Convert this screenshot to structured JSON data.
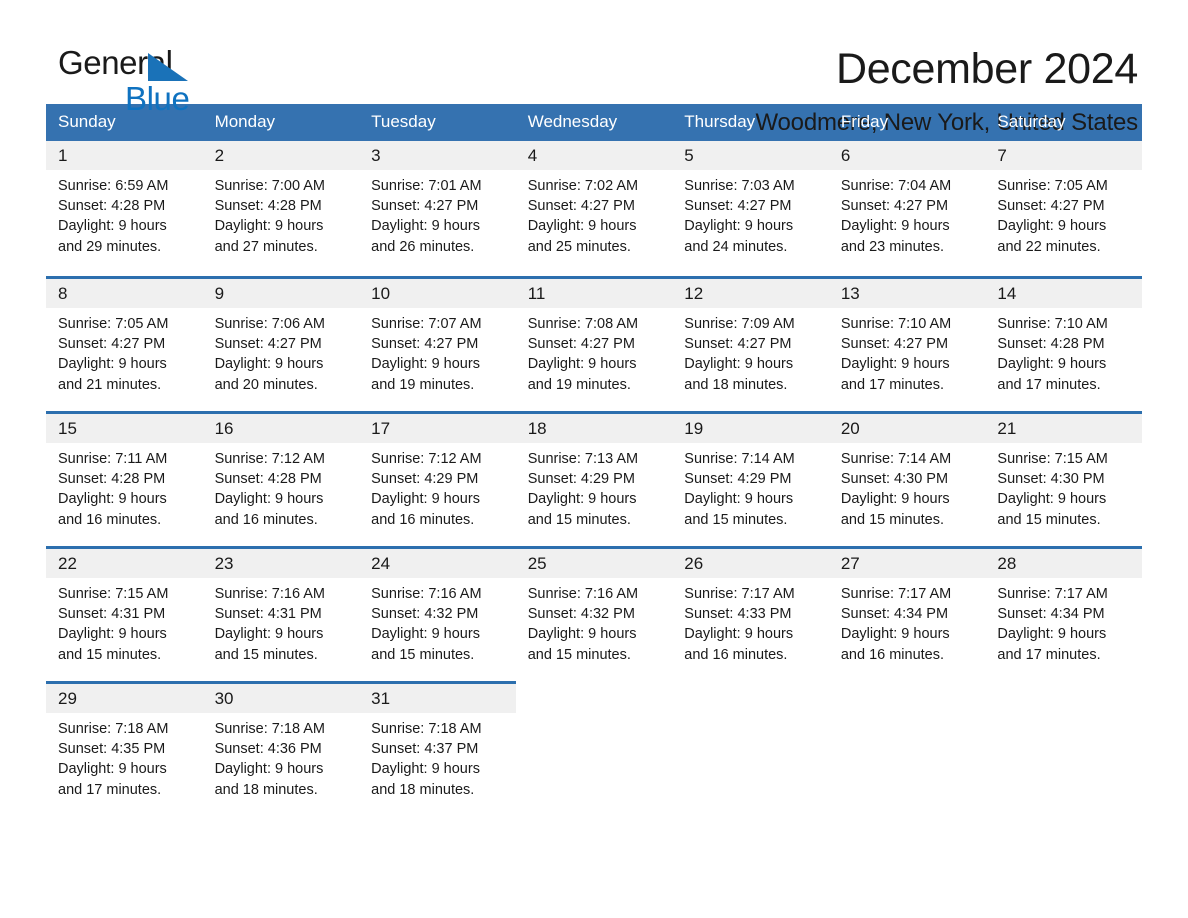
{
  "brand": {
    "logo_text_1": "General",
    "logo_text_2": "Blue",
    "triangle_icon": "triangle-icon",
    "accent_blue": "#1a72b8",
    "header_blue": "#3572b0",
    "band_gray": "#f0f0f0"
  },
  "header": {
    "title": "December 2024",
    "subtitle": "Woodmere, New York, United States"
  },
  "calendar": {
    "weekday_headers": [
      "Sunday",
      "Monday",
      "Tuesday",
      "Wednesday",
      "Thursday",
      "Friday",
      "Saturday"
    ],
    "weeks": [
      [
        {
          "day": "1",
          "sunrise": "Sunrise: 6:59 AM",
          "sunset": "Sunset: 4:28 PM",
          "daylight_1": "Daylight: 9 hours",
          "daylight_2": "and 29 minutes."
        },
        {
          "day": "2",
          "sunrise": "Sunrise: 7:00 AM",
          "sunset": "Sunset: 4:28 PM",
          "daylight_1": "Daylight: 9 hours",
          "daylight_2": "and 27 minutes."
        },
        {
          "day": "3",
          "sunrise": "Sunrise: 7:01 AM",
          "sunset": "Sunset: 4:27 PM",
          "daylight_1": "Daylight: 9 hours",
          "daylight_2": "and 26 minutes."
        },
        {
          "day": "4",
          "sunrise": "Sunrise: 7:02 AM",
          "sunset": "Sunset: 4:27 PM",
          "daylight_1": "Daylight: 9 hours",
          "daylight_2": "and 25 minutes."
        },
        {
          "day": "5",
          "sunrise": "Sunrise: 7:03 AM",
          "sunset": "Sunset: 4:27 PM",
          "daylight_1": "Daylight: 9 hours",
          "daylight_2": "and 24 minutes."
        },
        {
          "day": "6",
          "sunrise": "Sunrise: 7:04 AM",
          "sunset": "Sunset: 4:27 PM",
          "daylight_1": "Daylight: 9 hours",
          "daylight_2": "and 23 minutes."
        },
        {
          "day": "7",
          "sunrise": "Sunrise: 7:05 AM",
          "sunset": "Sunset: 4:27 PM",
          "daylight_1": "Daylight: 9 hours",
          "daylight_2": "and 22 minutes."
        }
      ],
      [
        {
          "day": "8",
          "sunrise": "Sunrise: 7:05 AM",
          "sunset": "Sunset: 4:27 PM",
          "daylight_1": "Daylight: 9 hours",
          "daylight_2": "and 21 minutes."
        },
        {
          "day": "9",
          "sunrise": "Sunrise: 7:06 AM",
          "sunset": "Sunset: 4:27 PM",
          "daylight_1": "Daylight: 9 hours",
          "daylight_2": "and 20 minutes."
        },
        {
          "day": "10",
          "sunrise": "Sunrise: 7:07 AM",
          "sunset": "Sunset: 4:27 PM",
          "daylight_1": "Daylight: 9 hours",
          "daylight_2": "and 19 minutes."
        },
        {
          "day": "11",
          "sunrise": "Sunrise: 7:08 AM",
          "sunset": "Sunset: 4:27 PM",
          "daylight_1": "Daylight: 9 hours",
          "daylight_2": "and 19 minutes."
        },
        {
          "day": "12",
          "sunrise": "Sunrise: 7:09 AM",
          "sunset": "Sunset: 4:27 PM",
          "daylight_1": "Daylight: 9 hours",
          "daylight_2": "and 18 minutes."
        },
        {
          "day": "13",
          "sunrise": "Sunrise: 7:10 AM",
          "sunset": "Sunset: 4:27 PM",
          "daylight_1": "Daylight: 9 hours",
          "daylight_2": "and 17 minutes."
        },
        {
          "day": "14",
          "sunrise": "Sunrise: 7:10 AM",
          "sunset": "Sunset: 4:28 PM",
          "daylight_1": "Daylight: 9 hours",
          "daylight_2": "and 17 minutes."
        }
      ],
      [
        {
          "day": "15",
          "sunrise": "Sunrise: 7:11 AM",
          "sunset": "Sunset: 4:28 PM",
          "daylight_1": "Daylight: 9 hours",
          "daylight_2": "and 16 minutes."
        },
        {
          "day": "16",
          "sunrise": "Sunrise: 7:12 AM",
          "sunset": "Sunset: 4:28 PM",
          "daylight_1": "Daylight: 9 hours",
          "daylight_2": "and 16 minutes."
        },
        {
          "day": "17",
          "sunrise": "Sunrise: 7:12 AM",
          "sunset": "Sunset: 4:29 PM",
          "daylight_1": "Daylight: 9 hours",
          "daylight_2": "and 16 minutes."
        },
        {
          "day": "18",
          "sunrise": "Sunrise: 7:13 AM",
          "sunset": "Sunset: 4:29 PM",
          "daylight_1": "Daylight: 9 hours",
          "daylight_2": "and 15 minutes."
        },
        {
          "day": "19",
          "sunrise": "Sunrise: 7:14 AM",
          "sunset": "Sunset: 4:29 PM",
          "daylight_1": "Daylight: 9 hours",
          "daylight_2": "and 15 minutes."
        },
        {
          "day": "20",
          "sunrise": "Sunrise: 7:14 AM",
          "sunset": "Sunset: 4:30 PM",
          "daylight_1": "Daylight: 9 hours",
          "daylight_2": "and 15 minutes."
        },
        {
          "day": "21",
          "sunrise": "Sunrise: 7:15 AM",
          "sunset": "Sunset: 4:30 PM",
          "daylight_1": "Daylight: 9 hours",
          "daylight_2": "and 15 minutes."
        }
      ],
      [
        {
          "day": "22",
          "sunrise": "Sunrise: 7:15 AM",
          "sunset": "Sunset: 4:31 PM",
          "daylight_1": "Daylight: 9 hours",
          "daylight_2": "and 15 minutes."
        },
        {
          "day": "23",
          "sunrise": "Sunrise: 7:16 AM",
          "sunset": "Sunset: 4:31 PM",
          "daylight_1": "Daylight: 9 hours",
          "daylight_2": "and 15 minutes."
        },
        {
          "day": "24",
          "sunrise": "Sunrise: 7:16 AM",
          "sunset": "Sunset: 4:32 PM",
          "daylight_1": "Daylight: 9 hours",
          "daylight_2": "and 15 minutes."
        },
        {
          "day": "25",
          "sunrise": "Sunrise: 7:16 AM",
          "sunset": "Sunset: 4:32 PM",
          "daylight_1": "Daylight: 9 hours",
          "daylight_2": "and 15 minutes."
        },
        {
          "day": "26",
          "sunrise": "Sunrise: 7:17 AM",
          "sunset": "Sunset: 4:33 PM",
          "daylight_1": "Daylight: 9 hours",
          "daylight_2": "and 16 minutes."
        },
        {
          "day": "27",
          "sunrise": "Sunrise: 7:17 AM",
          "sunset": "Sunset: 4:34 PM",
          "daylight_1": "Daylight: 9 hours",
          "daylight_2": "and 16 minutes."
        },
        {
          "day": "28",
          "sunrise": "Sunrise: 7:17 AM",
          "sunset": "Sunset: 4:34 PM",
          "daylight_1": "Daylight: 9 hours",
          "daylight_2": "and 17 minutes."
        }
      ],
      [
        {
          "day": "29",
          "sunrise": "Sunrise: 7:18 AM",
          "sunset": "Sunset: 4:35 PM",
          "daylight_1": "Daylight: 9 hours",
          "daylight_2": "and 17 minutes."
        },
        {
          "day": "30",
          "sunrise": "Sunrise: 7:18 AM",
          "sunset": "Sunset: 4:36 PM",
          "daylight_1": "Daylight: 9 hours",
          "daylight_2": "and 18 minutes."
        },
        {
          "day": "31",
          "sunrise": "Sunrise: 7:18 AM",
          "sunset": "Sunset: 4:37 PM",
          "daylight_1": "Daylight: 9 hours",
          "daylight_2": "and 18 minutes."
        },
        {
          "day": "",
          "sunrise": "",
          "sunset": "",
          "daylight_1": "",
          "daylight_2": ""
        },
        {
          "day": "",
          "sunrise": "",
          "sunset": "",
          "daylight_1": "",
          "daylight_2": ""
        },
        {
          "day": "",
          "sunrise": "",
          "sunset": "",
          "daylight_1": "",
          "daylight_2": ""
        },
        {
          "day": "",
          "sunrise": "",
          "sunset": "",
          "daylight_1": "",
          "daylight_2": ""
        }
      ]
    ]
  }
}
